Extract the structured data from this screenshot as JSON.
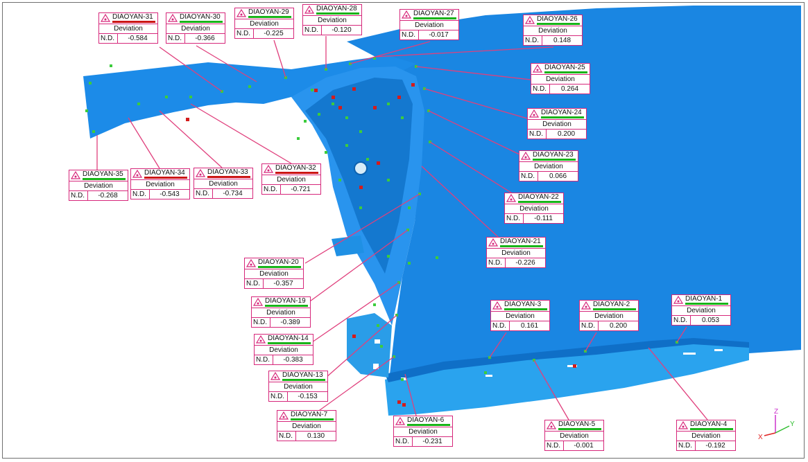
{
  "colors": {
    "part": "#1e8ce6",
    "callout_border": "#d6267a",
    "leader": "#e0407d",
    "ok_bar": "#18b418",
    "bad_bar": "#cc1414",
    "point_green": "#3ccc3c",
    "point_red": "#d41c1c"
  },
  "callouts": [
    {
      "title": "DIAOYAN-31",
      "label": "Deviation",
      "nd": "N.D.",
      "value": "-0.584",
      "status": "bad"
    },
    {
      "title": "DIAOYAN-30",
      "label": "Deviation",
      "nd": "N.D.",
      "value": "-0.366",
      "status": "ok"
    },
    {
      "title": "DIAOYAN-29",
      "label": "Deviation",
      "nd": "N.D.",
      "value": "-0.225",
      "status": "ok"
    },
    {
      "title": "DIAOYAN-28",
      "label": "Deviation",
      "nd": "N.D.",
      "value": "-0.120",
      "status": "ok"
    },
    {
      "title": "DIAOYAN-27",
      "label": "Deviation",
      "nd": "N.D.",
      "value": "-0.017",
      "status": "ok"
    },
    {
      "title": "DIAOYAN-26",
      "label": "Deviation",
      "nd": "N.D.",
      "value": "0.148",
      "status": "ok"
    },
    {
      "title": "DIAOYAN-25",
      "label": "Deviation",
      "nd": "N.D.",
      "value": "0.264",
      "status": "ok"
    },
    {
      "title": "DIAOYAN-24",
      "label": "Deviation",
      "nd": "N.D.",
      "value": "0.200",
      "status": "ok"
    },
    {
      "title": "DIAOYAN-23",
      "label": "Deviation",
      "nd": "N.D.",
      "value": "0.066",
      "status": "ok"
    },
    {
      "title": "DIAOYAN-22",
      "label": "Deviation",
      "nd": "N.D.",
      "value": "-0.111",
      "status": "ok"
    },
    {
      "title": "DIAOYAN-21",
      "label": "Deviation",
      "nd": "N.D.",
      "value": "-0.226",
      "status": "ok"
    },
    {
      "title": "DIAOYAN-35",
      "label": "Deviation",
      "nd": "N.D.",
      "value": "-0.268",
      "status": "ok"
    },
    {
      "title": "DIAOYAN-34",
      "label": "Deviation",
      "nd": "N.D.",
      "value": "-0.543",
      "status": "bad"
    },
    {
      "title": "DIAOYAN-33",
      "label": "Deviation",
      "nd": "N.D.",
      "value": "-0.734",
      "status": "bad"
    },
    {
      "title": "DIAOYAN-32",
      "label": "Deviation",
      "nd": "N.D.",
      "value": "-0.721",
      "status": "bad"
    },
    {
      "title": "DIAOYAN-20",
      "label": "Deviation",
      "nd": "N.D.",
      "value": "-0.357",
      "status": "ok"
    },
    {
      "title": "DIAOYAN-19",
      "label": "Deviation",
      "nd": "N.D.",
      "value": "-0.389",
      "status": "ok"
    },
    {
      "title": "DIAOYAN-14",
      "label": "Deviation",
      "nd": "N.D.",
      "value": "-0.383",
      "status": "ok"
    },
    {
      "title": "DIAOYAN-13",
      "label": "Deviation",
      "nd": "N.D.",
      "value": "-0.153",
      "status": "ok"
    },
    {
      "title": "DIAOYAN-7",
      "label": "Deviation",
      "nd": "N.D.",
      "value": "0.130",
      "status": "ok"
    },
    {
      "title": "DIAOYAN-6",
      "label": "Deviation",
      "nd": "N.D.",
      "value": "-0.231",
      "status": "ok"
    },
    {
      "title": "DIAOYAN-5",
      "label": "Deviation",
      "nd": "N.D.",
      "value": "-0.001",
      "status": "ok"
    },
    {
      "title": "DIAOYAN-4",
      "label": "Deviation",
      "nd": "N.D.",
      "value": "-0.192",
      "status": "ok"
    },
    {
      "title": "DIAOYAN-3",
      "label": "Deviation",
      "nd": "N.D.",
      "value": "0.161",
      "status": "ok"
    },
    {
      "title": "DIAOYAN-2",
      "label": "Deviation",
      "nd": "N.D.",
      "value": "0.200",
      "status": "ok"
    },
    {
      "title": "DIAOYAN-1",
      "label": "Deviation",
      "nd": "N.D.",
      "value": "0.053",
      "status": "ok"
    }
  ],
  "triad": {
    "x": "X",
    "y": "Y",
    "z": "Z"
  }
}
